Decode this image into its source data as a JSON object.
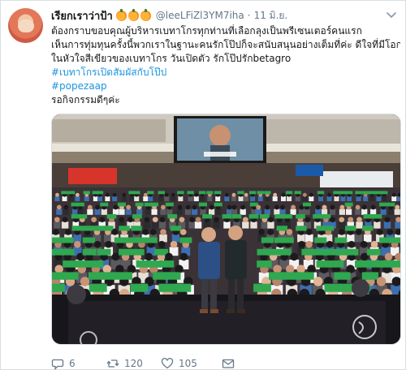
{
  "tweet": {
    "display_name": "เรียกเราว่าป้า",
    "handle": "@leeLFiZl3YM7iha",
    "separator": "·",
    "time": "11 มิ.ย.",
    "lines": [
      "ต้องกราบขอบคุณผู้บริหารเบทาโกรทุกท่านที่เลือกลุงเป็นพรีเซนเตอร์คนแรก",
      "เห็นการทุ่มทุนครั้งนี้พวกเราในฐานะคนรักโป๊ปก็จะสนับสนุนอย่างเต็มที่ค่ะ ดีใจที่มีโอกาสยืน",
      "ในหัวใจสีเขียวของเบทาโกร    วันเปิดตัว รักโป๊ปรักbetagro"
    ],
    "hashtags": [
      "#เบทาโกรเปิดสัมผัสกับโป๊ป",
      "#popezaap"
    ],
    "closing_line": "รอกิจกรรมดีๆค่ะ",
    "emojis": [
      "tangerine-emoji",
      "tangerine-emoji",
      "tangerine-emoji"
    ],
    "menu_icon": "chevron-down-icon"
  },
  "actions": {
    "reply_count": "6",
    "retweet_count": "120",
    "like_count": "105",
    "reply_icon": "reply-icon",
    "retweet_icon": "retweet-icon",
    "like_icon": "heart-icon",
    "message_icon": "envelope-icon"
  },
  "colors": {
    "link": "#1b95e0",
    "meta": "#657786",
    "text": "#14171a",
    "crowd_green": "#2fa84f"
  }
}
